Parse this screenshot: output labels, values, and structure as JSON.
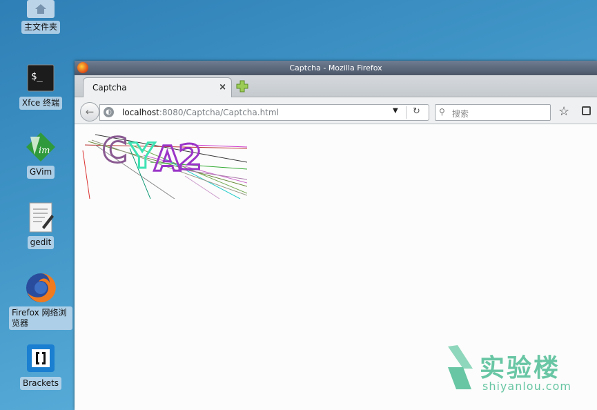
{
  "desktop": {
    "icons": [
      {
        "label": "主文件夹"
      },
      {
        "label": "Xfce 终端"
      },
      {
        "label": "GVim"
      },
      {
        "label": "gedit"
      },
      {
        "label": "Firefox 网络浏览器"
      },
      {
        "label": "Brackets"
      }
    ]
  },
  "window": {
    "title": "Captcha - Mozilla Firefox",
    "tab": {
      "title": "Captcha",
      "close": "×"
    },
    "url": {
      "host": "localhost",
      "rest": ":8080/Captcha/Captcha.html"
    },
    "search": {
      "placeholder": "搜索"
    }
  },
  "captcha": {
    "text": "CYA2"
  },
  "watermark": {
    "name_cn": "实验楼",
    "domain": "shiyanlou.com"
  },
  "colors": {
    "accent": "#68c6a4",
    "desktop_bg": "#3f94c6"
  }
}
